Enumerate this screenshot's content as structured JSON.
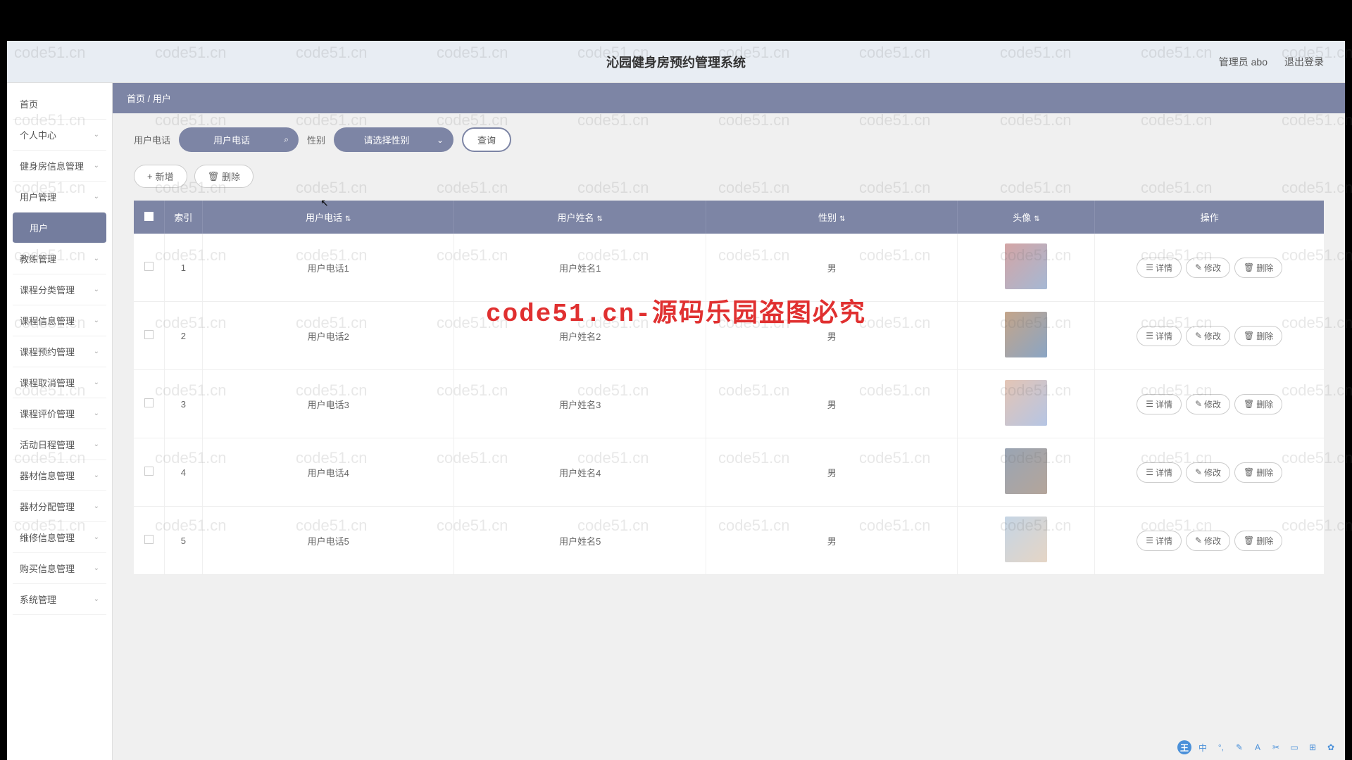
{
  "header": {
    "title": "沁园健身房预约管理系统",
    "admin_label": "管理员 abo",
    "logout_label": "退出登录"
  },
  "sidebar": {
    "home": "首页",
    "items": [
      {
        "label": "个人中心"
      },
      {
        "label": "健身房信息管理"
      },
      {
        "label": "用户管理"
      },
      {
        "label": "用户",
        "active": true
      },
      {
        "label": "教练管理"
      },
      {
        "label": "课程分类管理"
      },
      {
        "label": "课程信息管理"
      },
      {
        "label": "课程预约管理"
      },
      {
        "label": "课程取消管理"
      },
      {
        "label": "课程评价管理"
      },
      {
        "label": "活动日程管理"
      },
      {
        "label": "器材信息管理"
      },
      {
        "label": "器材分配管理"
      },
      {
        "label": "维修信息管理"
      },
      {
        "label": "购买信息管理"
      },
      {
        "label": "系统管理"
      }
    ]
  },
  "breadcrumb": {
    "home": "首页",
    "sep": " / ",
    "current": "用户"
  },
  "filters": {
    "phone_label": "用户电话",
    "phone_placeholder": "用户电话",
    "gender_label": "性别",
    "gender_placeholder": "请选择性别",
    "query_btn": "查询"
  },
  "actions": {
    "add": "新增",
    "delete": "删除"
  },
  "table": {
    "headers": {
      "index": "索引",
      "phone": "用户电话",
      "name": "用户姓名",
      "gender": "性别",
      "avatar": "头像",
      "ops": "操作"
    },
    "row_buttons": {
      "detail": "详情",
      "edit": "修改",
      "delete": "删除"
    },
    "rows": [
      {
        "idx": "1",
        "phone": "用户电话1",
        "name": "用户姓名1",
        "gender": "男"
      },
      {
        "idx": "2",
        "phone": "用户电话2",
        "name": "用户姓名2",
        "gender": "男"
      },
      {
        "idx": "3",
        "phone": "用户电话3",
        "name": "用户姓名3",
        "gender": "男"
      },
      {
        "idx": "4",
        "phone": "用户电话4",
        "name": "用户姓名4",
        "gender": "男"
      },
      {
        "idx": "5",
        "phone": "用户电话5",
        "name": "用户姓名5",
        "gender": "男"
      }
    ]
  },
  "watermark_text": "code51.cn",
  "watermark_red": "code51.cn-源码乐园盗图必究"
}
